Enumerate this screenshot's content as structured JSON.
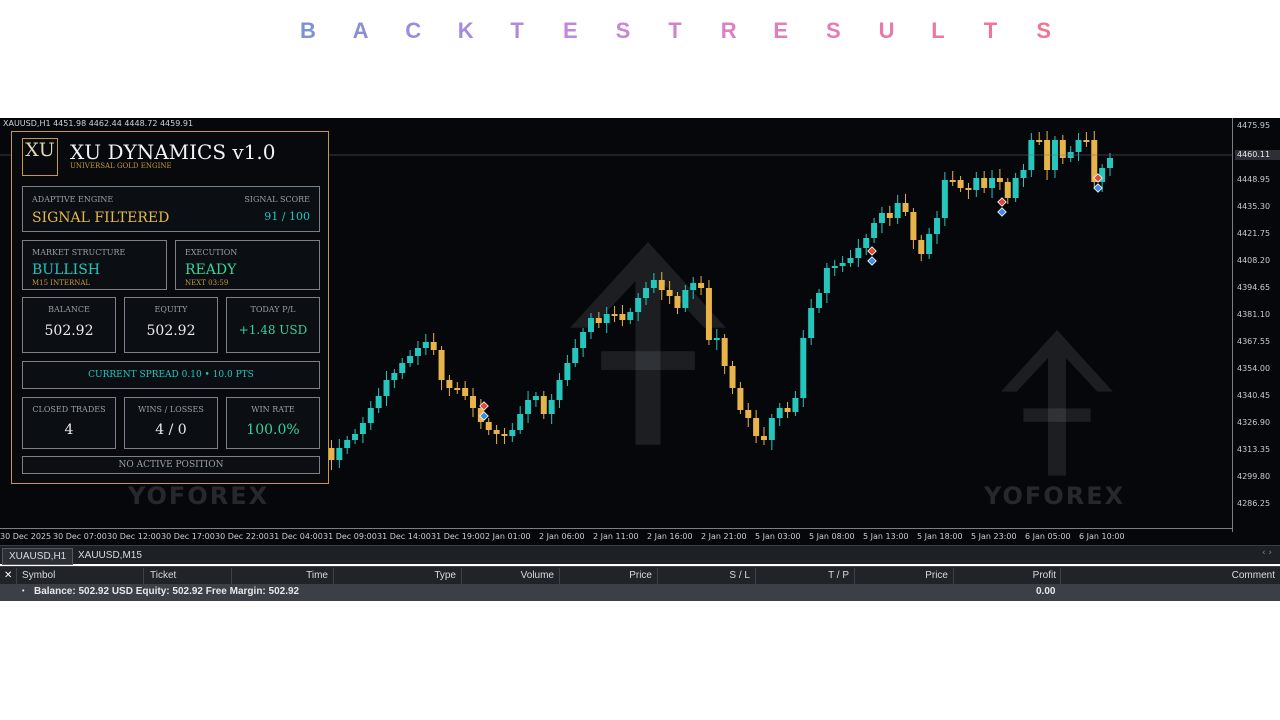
{
  "banner": {
    "letters": [
      "B",
      "A",
      "C",
      "K",
      "T",
      "E",
      "S",
      "T",
      "R",
      "E",
      "S",
      "U",
      "L",
      "T",
      "S"
    ],
    "colors": [
      "#7b93d6",
      "#8a90d8",
      "#988edb",
      "#a48cdc",
      "#b28adc",
      "#c087db",
      "#ca85d6",
      "#d482cf",
      "#dc80c6",
      "#e27ebd",
      "#e67cb4",
      "#ea7aab",
      "#ec78a2",
      "#ee769a",
      "#ef7593"
    ]
  },
  "chart": {
    "symbol_header": "XAUUSD,H1  4451.98 4462.44 4448.72 4459.91",
    "price_ticks": [
      "4475.95",
      "4448.95",
      "4435.30",
      "4421.75",
      "4408.20",
      "4394.65",
      "4381.10",
      "4367.55",
      "4354.00",
      "4340.45",
      "4326.90",
      "4313.35",
      "4299.80",
      "4286.25"
    ],
    "current_price": "4460.11",
    "time_labels": [
      "30 Dec 2025",
      "30 Dec 07:00",
      "30 Dec 12:00",
      "30 Dec 17:00",
      "30 Dec 22:00",
      "31 Dec 04:00",
      "31 Dec 09:00",
      "31 Dec 14:00",
      "31 Dec 19:00",
      "2 Jan 01:00",
      "2 Jan 06:00",
      "2 Jan 11:00",
      "2 Jan 16:00",
      "2 Jan 21:00",
      "5 Jan 03:00",
      "5 Jan 08:00",
      "5 Jan 13:00",
      "5 Jan 18:00",
      "5 Jan 23:00",
      "6 Jan 05:00",
      "6 Jan 10:00"
    ],
    "watermark": "YOFOREX",
    "colors": {
      "bull": "#26c6bd",
      "bear": "#e8b449",
      "background": "#05070a"
    }
  },
  "panel": {
    "logo": "XU",
    "title": "XU DYNAMICS v1.0",
    "subtitle": "UNIVERSAL GOLD ENGINE",
    "adaptive_label": "ADAPTIVE ENGINE",
    "adaptive_value": "SIGNAL FILTERED",
    "score_label": "SIGNAL SCORE",
    "score_value": "91 / 100",
    "structure_label": "MARKET STRUCTURE",
    "structure_value": "BULLISH",
    "structure_note": "M15 INTERNAL",
    "execution_label": "EXECUTION",
    "execution_value": "READY",
    "execution_note": "NEXT 03:59",
    "balance_label": "BALANCE",
    "balance_value": "502.92",
    "equity_label": "EQUITY",
    "equity_value": "502.92",
    "pl_label": "TODAY P/L",
    "pl_value": "+1.48 USD",
    "spread_text": "CURRENT SPREAD  0.10  •  10.0 PTS",
    "closed_label": "CLOSED TRADES",
    "closed_value": "4",
    "wl_label": "WINS / LOSSES",
    "wl_value": "4 / 0",
    "winrate_label": "WIN RATE",
    "winrate_value": "100.0%",
    "position_text": "NO ACTIVE POSITION"
  },
  "tabs": [
    "XUAUSD,H1",
    "XAUUSD,M15"
  ],
  "tab_arrows": "‹ ›",
  "terminal": {
    "close": "✕",
    "columns": [
      "Symbol",
      "Ticket",
      "Time",
      "Type",
      "Volume",
      "Price",
      "S / L",
      "T / P",
      "Price",
      "Profit",
      "Comment"
    ],
    "bullet": "•",
    "summary": "Balance: 502.92 USD  Equity: 502.92  Free Margin: 502.92",
    "profit": "0.00"
  }
}
